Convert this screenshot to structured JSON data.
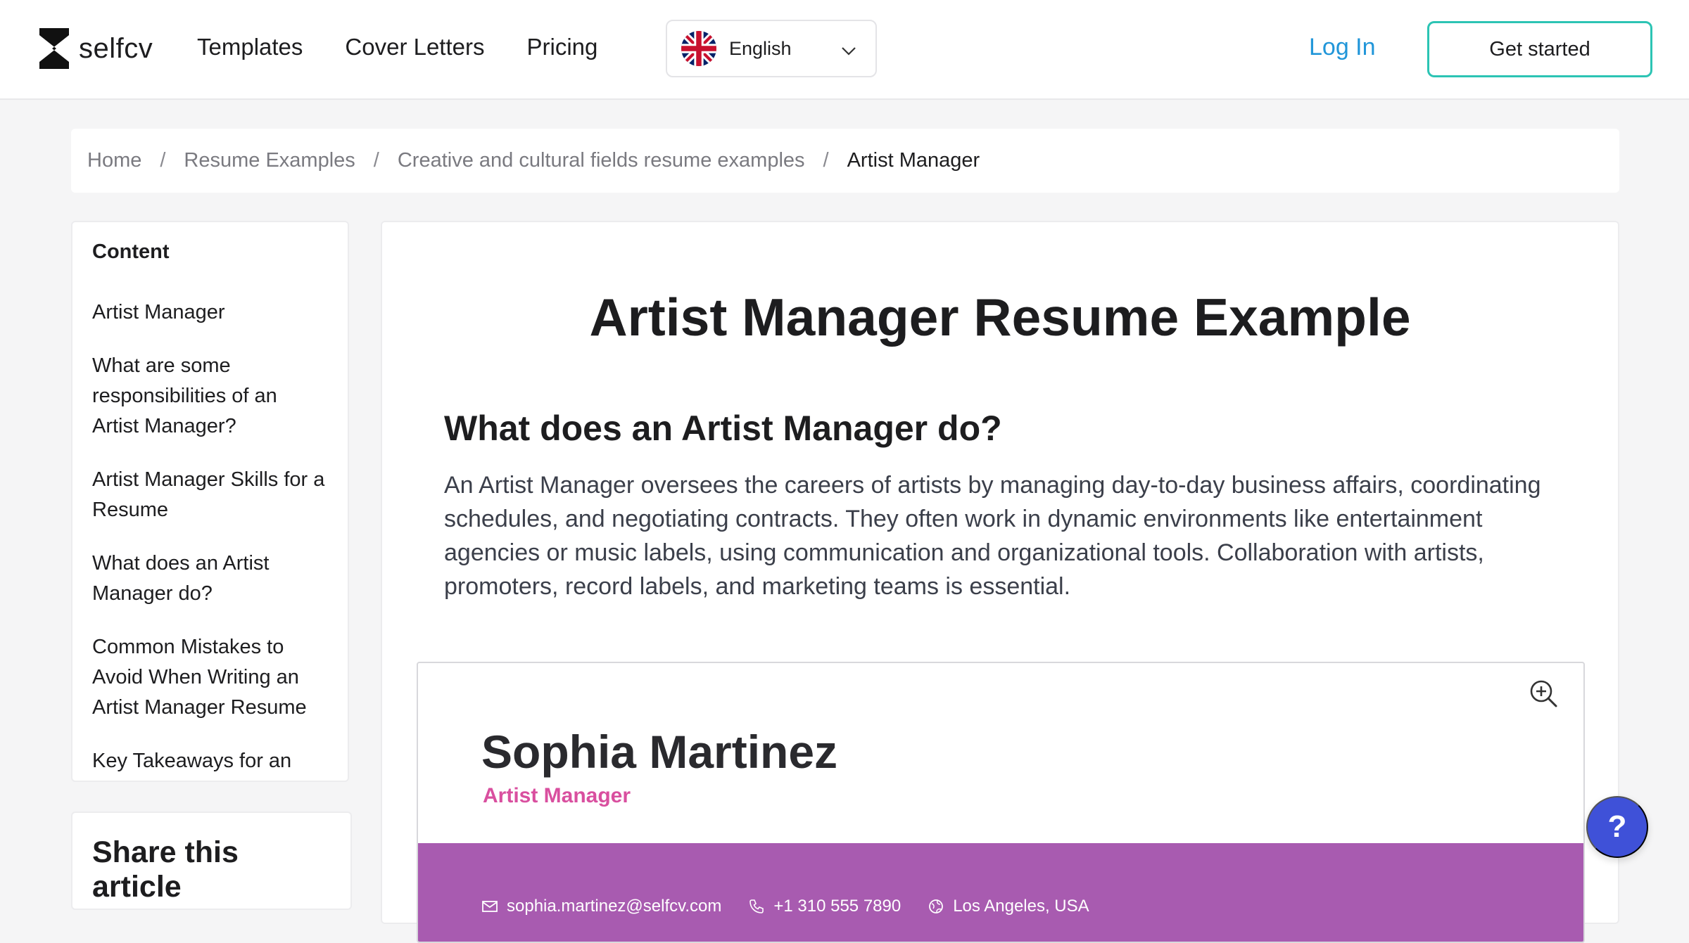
{
  "header": {
    "logo_text": "selfcv",
    "nav": [
      {
        "label": "Templates"
      },
      {
        "label": "Cover Letters"
      },
      {
        "label": "Pricing"
      }
    ],
    "language": {
      "selected": "English",
      "flag_icon": "uk-flag-icon"
    },
    "login_label": "Log In",
    "cta_label": "Get started",
    "colors": {
      "login": "#2196d9",
      "cta_border": "#2cc4b4"
    }
  },
  "breadcrumb": {
    "items": [
      "Home",
      "Resume Examples",
      "Creative and cultural fields resume examples"
    ],
    "current": "Artist Manager",
    "separator": "/"
  },
  "toc": {
    "title": "Content",
    "items": [
      "Artist Manager",
      "What are some responsibilities of an Artist Manager?",
      "Artist Manager Skills for a Resume",
      "What does an Artist Manager do?",
      "Common Mistakes to Avoid When Writing an Artist Manager Resume",
      "Key Takeaways for an"
    ]
  },
  "share": {
    "title": "Share this article"
  },
  "article": {
    "title": "Artist Manager Resume Example",
    "section_heading": "What does an Artist Manager do?",
    "section_body": "An Artist Manager oversees the careers of artists by managing day-to-day business affairs, coordinating schedules, and negotiating contracts. They often work in dynamic environments like entertainment agencies or music labels, using communication and organizational tools. Collaboration with artists, promoters, record labels, and marketing teams is essential."
  },
  "resume": {
    "name": "Sophia Martinez",
    "role": "Artist Manager",
    "email": "sophia.martinez@selfcv.com",
    "phone": "+1 310 555 7890",
    "location": "Los Angeles, USA",
    "colors": {
      "role": "#d94f9f",
      "bar": "#a85bb0"
    }
  },
  "help": {
    "label": "?",
    "color": "#3f51d8"
  }
}
